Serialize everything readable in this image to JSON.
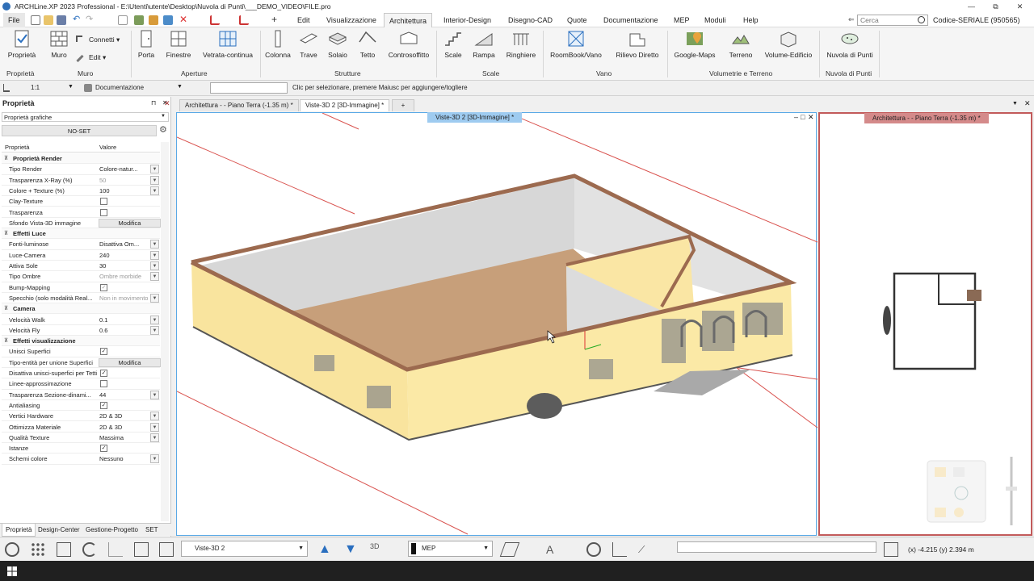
{
  "app": {
    "title": "ARCHLine.XP 2023 Professional - E:\\Utenti\\utente\\Desktop\\Nuvola di Punti\\___DEMO_VIDEO\\FILE.pro",
    "min": "—",
    "max": "⧉",
    "close": "✕"
  },
  "menu": {
    "file": "File",
    "items": [
      "Edit",
      "Visualizzazione",
      "Architettura",
      "Interior-Design",
      "Disegno-CAD",
      "Quote",
      "Documentazione",
      "MEP",
      "Moduli",
      "Help"
    ],
    "search_placeholder": "Cerca",
    "serial": "Codice-SERIALE (950565)"
  },
  "ribbon": {
    "buttons": {
      "proprieta": "Proprietà",
      "muro": "Muro",
      "connetti": "Connetti",
      "edit": "Edit",
      "porta": "Porta",
      "finestre": "Finestre",
      "vetrata": "Vetrata-continua",
      "colonna": "Colonna",
      "trave": "Trave",
      "solaio": "Solaio",
      "tetto": "Tetto",
      "controsoffitto": "Controsoffitto",
      "scale": "Scale",
      "rampa": "Rampa",
      "ringhiere": "Ringhiere",
      "roombook": "RoomBook/Vano",
      "rilievo": "Rilievo Diretto",
      "googlemaps": "Google-Maps",
      "terreno": "Terreno",
      "volume": "Volume-Edificio",
      "nuvola": "Nuvola di Punti"
    },
    "groups": {
      "proprieta": "Proprietà",
      "muro": "Muro",
      "aperture": "Aperture",
      "strutture": "Strutture",
      "scale": "Scale",
      "vano": "Vano",
      "volumetrie": "Volumetrie e Terreno",
      "nuvola": "Nuvola di Punti"
    }
  },
  "optbar": {
    "scale": "1:1",
    "layer": "Documentazione",
    "hint": "Clic per selezionare, premere Maiusc per aggiungere/togliere"
  },
  "panel": {
    "title": "Proprietà",
    "pin": "⊓",
    "close": "✕",
    "selector": "Proprietà grafiche",
    "noset": "NO-SET",
    "col_key": "Proprietà",
    "col_val": "Valore",
    "rows": [
      {
        "type": "sec",
        "k": "Proprietà Render"
      },
      {
        "type": "dd",
        "k": "Tipo Render",
        "v": "Colore-natur..."
      },
      {
        "type": "dd",
        "k": "Trasparenza X-Ray (%)",
        "v": "50",
        "grey": true
      },
      {
        "type": "dd",
        "k": "Colore + Texture (%)",
        "v": "100"
      },
      {
        "type": "cb",
        "k": "Clay-Texture",
        "v": ""
      },
      {
        "type": "cb",
        "k": "Trasparenza",
        "v": ""
      },
      {
        "type": "btn",
        "k": "Sfondo Vista-3D immagine",
        "v": "Modifica"
      },
      {
        "type": "sec",
        "k": "Effetti Luce"
      },
      {
        "type": "dd",
        "k": "Fonti-luminose",
        "v": "Disattiva Om..."
      },
      {
        "type": "dd",
        "k": "Luce-Camera",
        "v": "240"
      },
      {
        "type": "dd",
        "k": "Attiva Sole",
        "v": "30"
      },
      {
        "type": "dd",
        "k": "Tipo Ombre",
        "v": "Ombre morbide",
        "grey": true
      },
      {
        "type": "cb",
        "k": "Bump-Mapping",
        "v": "✓",
        "grey": true
      },
      {
        "type": "dd",
        "k": "Specchio (solo modalità Real...",
        "v": "Non in movimento",
        "grey": true
      },
      {
        "type": "sec",
        "k": "Camera"
      },
      {
        "type": "dd",
        "k": "Velocità Walk",
        "v": "0.1"
      },
      {
        "type": "dd",
        "k": "Velocità Fly",
        "v": "0.6"
      },
      {
        "type": "sec",
        "k": "Effetti visualizzazione"
      },
      {
        "type": "cb",
        "k": "Unisci Superfici",
        "v": "✓"
      },
      {
        "type": "btn",
        "k": "Tipo-entità per unione Superfici",
        "v": "Modifica"
      },
      {
        "type": "cb",
        "k": "Disattiva unisci-superfici per Tetti",
        "v": "✓"
      },
      {
        "type": "cb",
        "k": "Linee-approssimazione",
        "v": ""
      },
      {
        "type": "dd",
        "k": "Trasparenza Sezione-dinami...",
        "v": "44"
      },
      {
        "type": "cb",
        "k": "Antialiasing",
        "v": "✓"
      },
      {
        "type": "dd",
        "k": "Vertici Hardware",
        "v": "2D & 3D"
      },
      {
        "type": "dd",
        "k": "Ottimizza Materiale",
        "v": "2D & 3D"
      },
      {
        "type": "dd",
        "k": "Qualità Texture",
        "v": "Massima"
      },
      {
        "type": "cb",
        "k": "Istanze",
        "v": "✓"
      },
      {
        "type": "dd",
        "k": "Schemi colore",
        "v": "Nessuno"
      }
    ],
    "tabs": [
      "Proprietà",
      "Design-Center",
      "Gestione-Progetto",
      "SET"
    ]
  },
  "doctabs": {
    "tab1": "Architettura -  - Piano Terra (-1.35 m) *",
    "tab2": "Viste-3D 2 [3D-Immagine] *",
    "add": "+"
  },
  "views": {
    "v3d_label": "Viste-3D 2 [3D-Immagine] *",
    "v2d_label": "Architettura -  - Piano Terra (-1.35 m) *"
  },
  "statusbar": {
    "view": "Viste-3D 2",
    "layer": "MEP",
    "coords": "(x) -4.215  (y) 2.394 m"
  },
  "colors": {
    "accent": "#5aa9e6",
    "wall": "#fbe9a6",
    "wall_top": "#a8735a",
    "floor": "#c49a74",
    "active_view_border": "#c25a5a"
  }
}
